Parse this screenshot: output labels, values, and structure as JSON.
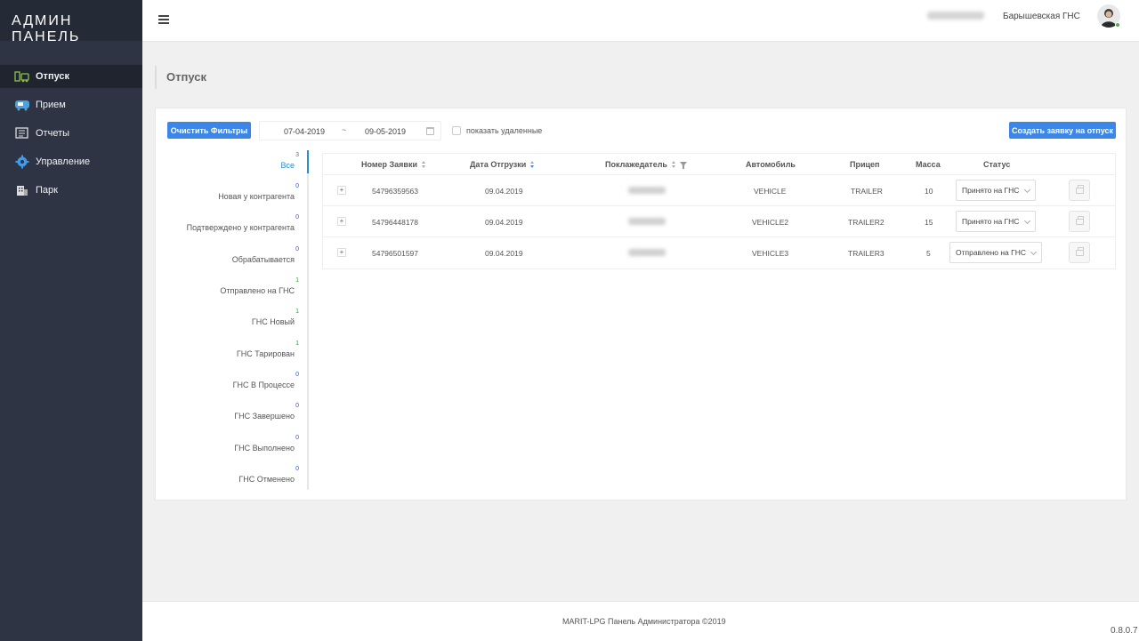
{
  "sidebar": {
    "brand": "АДМИН ПАНЕЛЬ",
    "items": [
      {
        "label": "Отпуск",
        "icon": "gas-dispenser-icon",
        "active": true
      },
      {
        "label": "Прием",
        "icon": "truck-icon"
      },
      {
        "label": "Отчеты",
        "icon": "report-icon"
      },
      {
        "label": "Управление",
        "icon": "gear-icon"
      },
      {
        "label": "Парк",
        "icon": "building-icon"
      }
    ]
  },
  "header": {
    "station": "Барышевская ГНС"
  },
  "page": {
    "title": "Отпуск"
  },
  "toolbar": {
    "clear_label": "Очистить Фильтры",
    "date_from": "07-04-2019",
    "date_sep": "~",
    "date_to": "09-05-2019",
    "show_deleted_label": "показать удаленные",
    "create_label": "Создать заявку на отпуск"
  },
  "filters": [
    {
      "label": "Все",
      "count": "3",
      "active": true
    },
    {
      "label": "Новая у контрагента",
      "count": "0"
    },
    {
      "label": "Подтверждено у контрагента",
      "count": "0"
    },
    {
      "label": "Обрабатывается",
      "count": "0"
    },
    {
      "label": "Отправлено на ГНС",
      "count": "1"
    },
    {
      "label": "ГНС Новый",
      "count": "1"
    },
    {
      "label": "ГНС Тарирован",
      "count": "1"
    },
    {
      "label": "ГНС В Процессе",
      "count": "0"
    },
    {
      "label": "ГНС Завершено",
      "count": "0"
    },
    {
      "label": "ГНС Выполнено",
      "count": "0"
    },
    {
      "label": "ГНС Отменено",
      "count": "0"
    }
  ],
  "table": {
    "columns": {
      "number": "Номер Заявки",
      "date": "Дата Отгрузки",
      "customer": "Поклажедатель",
      "vehicle": "Автомобиль",
      "trailer": "Прицеп",
      "mass": "Масса",
      "status": "Статус"
    },
    "rows": [
      {
        "expand": "+",
        "number": "54796359563",
        "date": "09.04.2019",
        "vehicle": "VEHICLE",
        "trailer": "TRAILER",
        "mass": "10",
        "status": "Принято на ГНС"
      },
      {
        "expand": "+",
        "number": "54796448178",
        "date": "09.04.2019",
        "vehicle": "VEHICLE2",
        "trailer": "TRAILER2",
        "mass": "15",
        "status": "Принято на ГНС"
      },
      {
        "expand": "+",
        "number": "54796501597",
        "date": "09.04.2019",
        "vehicle": "VEHICLE3",
        "trailer": "TRAILER3",
        "mass": "5",
        "status": "Отправлено на ГНС"
      }
    ]
  },
  "footer": {
    "text": "MARIT-LPG Панель Администратора ©2019",
    "version": "0.8.0.7"
  },
  "colors": {
    "sidebar_bg": "#2e3444",
    "accent_blue": "#3c86e8",
    "active_filter": "#2b8cc8"
  }
}
